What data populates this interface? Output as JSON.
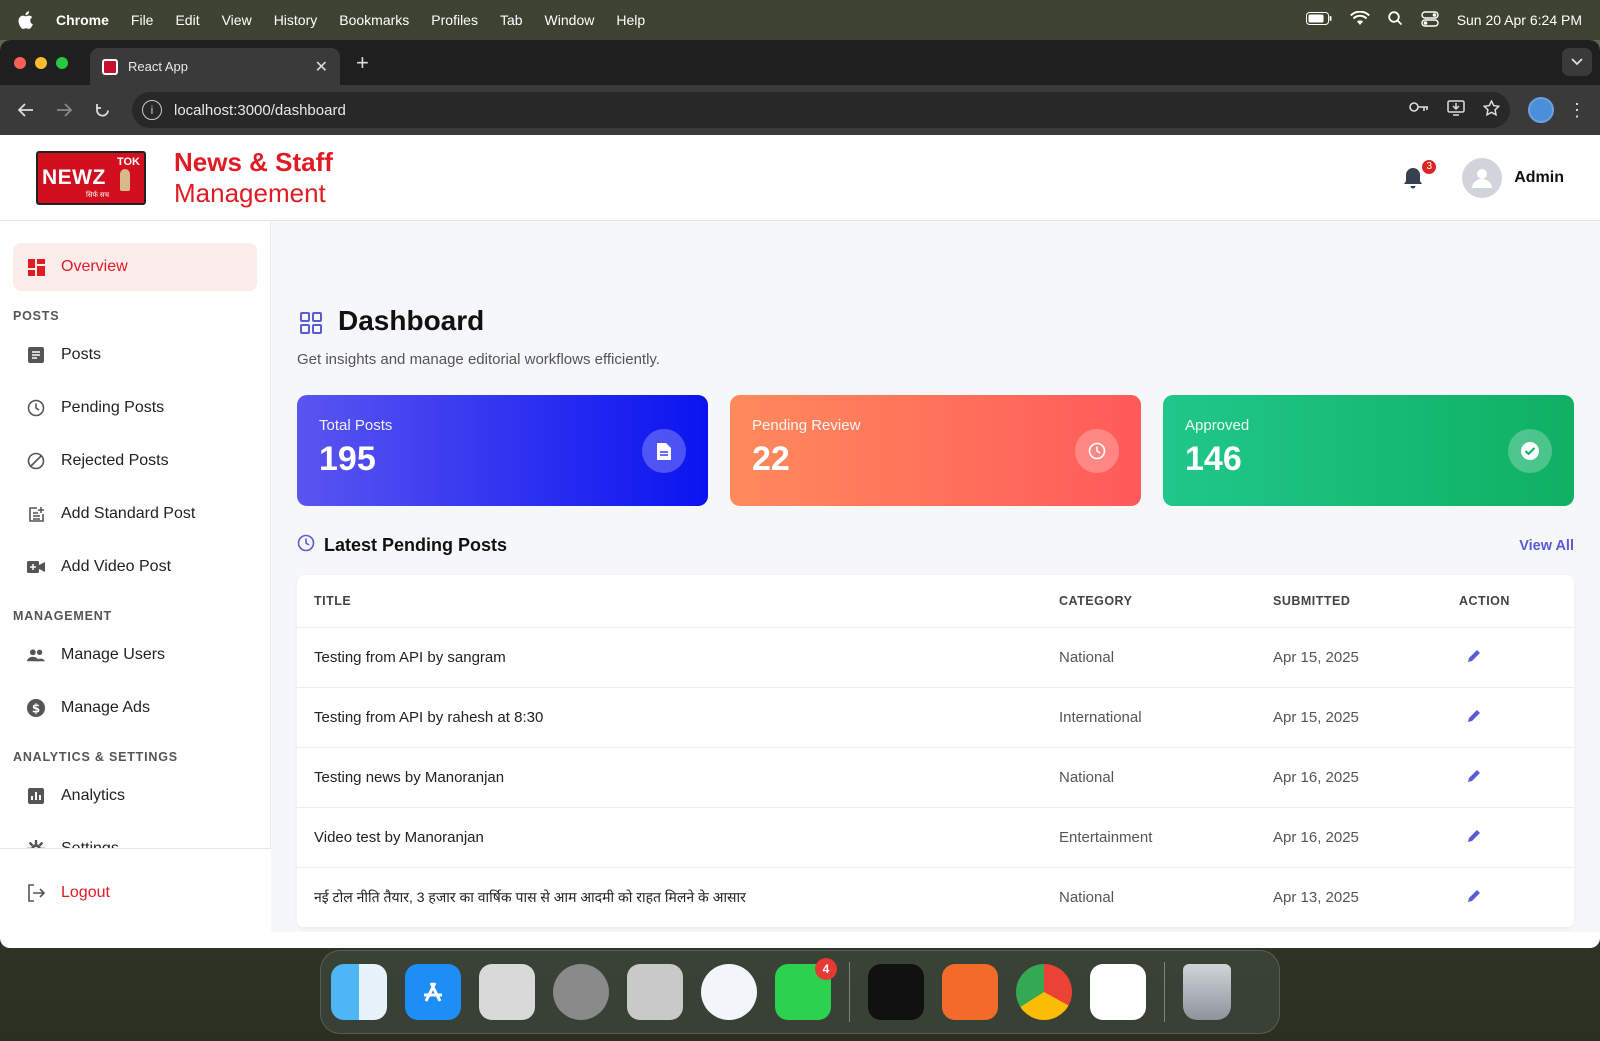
{
  "menubar": {
    "app": "Chrome",
    "items": [
      "File",
      "Edit",
      "View",
      "History",
      "Bookmarks",
      "Profiles",
      "Tab",
      "Window",
      "Help"
    ],
    "clock": "Sun 20 Apr  6:24 PM"
  },
  "browser": {
    "tab_title": "React App",
    "url": "localhost:3000/dashboard"
  },
  "header": {
    "logo_text": "NEWZ",
    "logo_tok": "TOK",
    "logo_sub": "सिर्फ सच",
    "brand_line1": "News & Staff",
    "brand_line2": "Management",
    "notification_count": "3",
    "user_name": "Admin"
  },
  "sidebar": {
    "overview": "Overview",
    "sections": {
      "posts": "POSTS",
      "management": "MANAGEMENT",
      "analytics": "ANALYTICS & SETTINGS"
    },
    "posts_items": [
      "Posts",
      "Pending Posts",
      "Rejected Posts",
      "Add Standard Post",
      "Add Video Post"
    ],
    "management_items": [
      "Manage Users",
      "Manage Ads"
    ],
    "analytics_items": [
      "Analytics",
      "Settings"
    ],
    "logout": "Logout"
  },
  "dashboard": {
    "title": "Dashboard",
    "subtitle": "Get insights and manage editorial workflows efficiently.",
    "stats": [
      {
        "label": "Total Posts",
        "value": "195"
      },
      {
        "label": "Pending Review",
        "value": "22"
      },
      {
        "label": "Approved",
        "value": "146"
      }
    ],
    "latest_title": "Latest Pending Posts",
    "view_all": "View All",
    "columns": [
      "TITLE",
      "CATEGORY",
      "SUBMITTED",
      "ACTION"
    ],
    "rows": [
      {
        "title": "Testing from API by sangram",
        "category": "National",
        "submitted": "Apr 15, 2025"
      },
      {
        "title": "Testing from API by rahesh at 8:30",
        "category": "International",
        "submitted": "Apr 15, 2025"
      },
      {
        "title": "Testing news by Manoranjan",
        "category": "National",
        "submitted": "Apr 16, 2025"
      },
      {
        "title": "Video test by Manoranjan",
        "category": "Entertainment",
        "submitted": "Apr 16, 2025"
      },
      {
        "title": "नई टोल नीति तैयार, 3 हजार का वार्षिक पास से आम आदमी को राहत मिलने के आसार",
        "category": "National",
        "submitted": "Apr 13, 2025"
      }
    ]
  },
  "dock": {
    "whatsapp_badge": "4"
  },
  "colors": {
    "brand_red": "#e01b24",
    "accent_indigo": "#5b5bd6",
    "stat_blue": "#0a14f0",
    "stat_orange": "#ff5a5a",
    "stat_green": "#0fb062"
  }
}
